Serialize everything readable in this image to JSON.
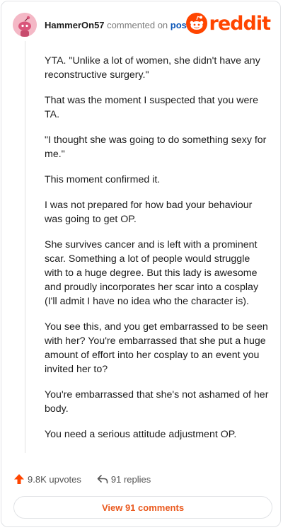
{
  "header": {
    "username": "HammerOn57",
    "action_text": "commented on",
    "post_link": "post",
    "logo_text": "reddit"
  },
  "comment": {
    "paragraphs": [
      "YTA. \"Unlike a lot of women, she didn't have any reconstructive surgery.\"",
      "That was the moment I suspected that you were TA.",
      "\"I thought she was going to do something sexy for me.\"",
      "This moment confirmed it.",
      "I was not prepared for how bad your behaviour was going to get OP.",
      "She survives cancer and is left with a prominent scar. Something a lot of people would struggle with to a huge degree. But this lady is awesome and proudly incorporates her scar into a cosplay (I'll admit I have no idea who the character is).",
      "You see this, and you get embarrassed to be seen with her? You're embarrassed that she put a huge amount of effort into her cosplay to an event you invited her to?",
      "You're embarrassed that she's not ashamed of her body.",
      "You need a serious attitude adjustment OP."
    ]
  },
  "actions": {
    "upvotes": "9.8K upvotes",
    "replies": "91 replies"
  },
  "view_comments_label": "View 91 comments",
  "colors": {
    "brand": "#ff4500",
    "link": "#0a55b8",
    "button_text": "#ea5a1f"
  },
  "icons": {
    "avatar": "snoo-avatar",
    "logo": "reddit-snoo-icon",
    "upvote": "upvote-arrow-icon",
    "reply": "reply-arrow-icon"
  }
}
